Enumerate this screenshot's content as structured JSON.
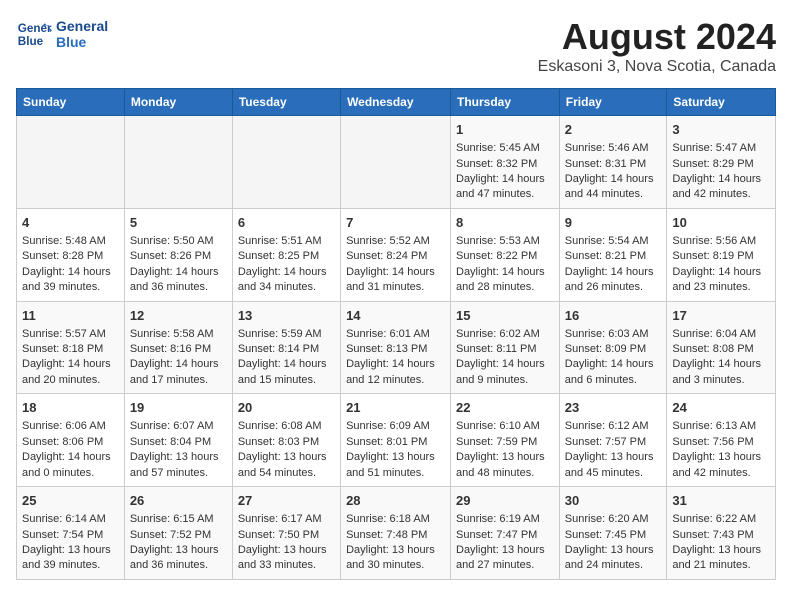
{
  "header": {
    "logo_line1": "General",
    "logo_line2": "Blue",
    "month_title": "August 2024",
    "subtitle": "Eskasoni 3, Nova Scotia, Canada"
  },
  "days_of_week": [
    "Sunday",
    "Monday",
    "Tuesday",
    "Wednesday",
    "Thursday",
    "Friday",
    "Saturday"
  ],
  "weeks": [
    [
      {
        "day": "",
        "content": ""
      },
      {
        "day": "",
        "content": ""
      },
      {
        "day": "",
        "content": ""
      },
      {
        "day": "",
        "content": ""
      },
      {
        "day": "1",
        "content": "Sunrise: 5:45 AM\nSunset: 8:32 PM\nDaylight: 14 hours and 47 minutes."
      },
      {
        "day": "2",
        "content": "Sunrise: 5:46 AM\nSunset: 8:31 PM\nDaylight: 14 hours and 44 minutes."
      },
      {
        "day": "3",
        "content": "Sunrise: 5:47 AM\nSunset: 8:29 PM\nDaylight: 14 hours and 42 minutes."
      }
    ],
    [
      {
        "day": "4",
        "content": "Sunrise: 5:48 AM\nSunset: 8:28 PM\nDaylight: 14 hours and 39 minutes."
      },
      {
        "day": "5",
        "content": "Sunrise: 5:50 AM\nSunset: 8:26 PM\nDaylight: 14 hours and 36 minutes."
      },
      {
        "day": "6",
        "content": "Sunrise: 5:51 AM\nSunset: 8:25 PM\nDaylight: 14 hours and 34 minutes."
      },
      {
        "day": "7",
        "content": "Sunrise: 5:52 AM\nSunset: 8:24 PM\nDaylight: 14 hours and 31 minutes."
      },
      {
        "day": "8",
        "content": "Sunrise: 5:53 AM\nSunset: 8:22 PM\nDaylight: 14 hours and 28 minutes."
      },
      {
        "day": "9",
        "content": "Sunrise: 5:54 AM\nSunset: 8:21 PM\nDaylight: 14 hours and 26 minutes."
      },
      {
        "day": "10",
        "content": "Sunrise: 5:56 AM\nSunset: 8:19 PM\nDaylight: 14 hours and 23 minutes."
      }
    ],
    [
      {
        "day": "11",
        "content": "Sunrise: 5:57 AM\nSunset: 8:18 PM\nDaylight: 14 hours and 20 minutes."
      },
      {
        "day": "12",
        "content": "Sunrise: 5:58 AM\nSunset: 8:16 PM\nDaylight: 14 hours and 17 minutes."
      },
      {
        "day": "13",
        "content": "Sunrise: 5:59 AM\nSunset: 8:14 PM\nDaylight: 14 hours and 15 minutes."
      },
      {
        "day": "14",
        "content": "Sunrise: 6:01 AM\nSunset: 8:13 PM\nDaylight: 14 hours and 12 minutes."
      },
      {
        "day": "15",
        "content": "Sunrise: 6:02 AM\nSunset: 8:11 PM\nDaylight: 14 hours and 9 minutes."
      },
      {
        "day": "16",
        "content": "Sunrise: 6:03 AM\nSunset: 8:09 PM\nDaylight: 14 hours and 6 minutes."
      },
      {
        "day": "17",
        "content": "Sunrise: 6:04 AM\nSunset: 8:08 PM\nDaylight: 14 hours and 3 minutes."
      }
    ],
    [
      {
        "day": "18",
        "content": "Sunrise: 6:06 AM\nSunset: 8:06 PM\nDaylight: 14 hours and 0 minutes."
      },
      {
        "day": "19",
        "content": "Sunrise: 6:07 AM\nSunset: 8:04 PM\nDaylight: 13 hours and 57 minutes."
      },
      {
        "day": "20",
        "content": "Sunrise: 6:08 AM\nSunset: 8:03 PM\nDaylight: 13 hours and 54 minutes."
      },
      {
        "day": "21",
        "content": "Sunrise: 6:09 AM\nSunset: 8:01 PM\nDaylight: 13 hours and 51 minutes."
      },
      {
        "day": "22",
        "content": "Sunrise: 6:10 AM\nSunset: 7:59 PM\nDaylight: 13 hours and 48 minutes."
      },
      {
        "day": "23",
        "content": "Sunrise: 6:12 AM\nSunset: 7:57 PM\nDaylight: 13 hours and 45 minutes."
      },
      {
        "day": "24",
        "content": "Sunrise: 6:13 AM\nSunset: 7:56 PM\nDaylight: 13 hours and 42 minutes."
      }
    ],
    [
      {
        "day": "25",
        "content": "Sunrise: 6:14 AM\nSunset: 7:54 PM\nDaylight: 13 hours and 39 minutes."
      },
      {
        "day": "26",
        "content": "Sunrise: 6:15 AM\nSunset: 7:52 PM\nDaylight: 13 hours and 36 minutes."
      },
      {
        "day": "27",
        "content": "Sunrise: 6:17 AM\nSunset: 7:50 PM\nDaylight: 13 hours and 33 minutes."
      },
      {
        "day": "28",
        "content": "Sunrise: 6:18 AM\nSunset: 7:48 PM\nDaylight: 13 hours and 30 minutes."
      },
      {
        "day": "29",
        "content": "Sunrise: 6:19 AM\nSunset: 7:47 PM\nDaylight: 13 hours and 27 minutes."
      },
      {
        "day": "30",
        "content": "Sunrise: 6:20 AM\nSunset: 7:45 PM\nDaylight: 13 hours and 24 minutes."
      },
      {
        "day": "31",
        "content": "Sunrise: 6:22 AM\nSunset: 7:43 PM\nDaylight: 13 hours and 21 minutes."
      }
    ]
  ]
}
